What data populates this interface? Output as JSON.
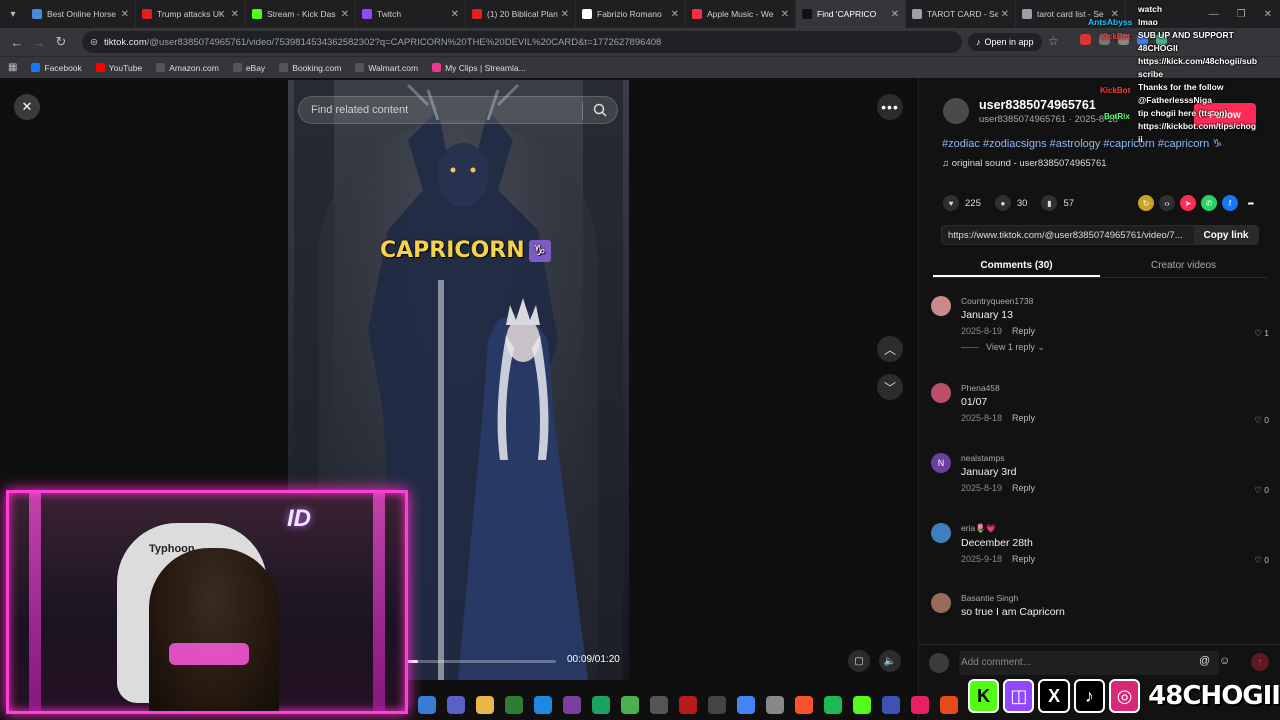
{
  "browser": {
    "tabs": [
      {
        "label": "Best Online Horse",
        "color": "#4a8bd8"
      },
      {
        "label": "Trump attacks UK",
        "color": "#e02020"
      },
      {
        "label": "Stream - Kick Das",
        "color": "#53fc18"
      },
      {
        "label": "Twitch",
        "color": "#9146ff"
      },
      {
        "label": "(1) 20 Biblical Plan",
        "color": "#e02020"
      },
      {
        "label": "Fabrizio Romano",
        "color": "#ffffff"
      },
      {
        "label": "Apple Music - We",
        "color": "#fa2d48"
      },
      {
        "label": "Find 'CAPRICO",
        "color": "#111111",
        "active": true
      },
      {
        "label": "TAROT CARD - Se",
        "color": "#9aa0a6"
      },
      {
        "label": "tarot card list - Se",
        "color": "#9aa0a6"
      }
    ],
    "url_host": "tiktok.com",
    "url_path": "/@user8385074965761/video/7539814534362582302?q=CAPRICORN%20THE%20DEVIL%20CARD&t=1772627896408",
    "open_in_app": "Open in app",
    "bookmarks": [
      {
        "label": "Facebook",
        "color": "#1877f2"
      },
      {
        "label": "YouTube",
        "color": "#ff0000"
      },
      {
        "label": "Amazon.com",
        "color": "#555555"
      },
      {
        "label": "eBay",
        "color": "#555555"
      },
      {
        "label": "Booking.com",
        "color": "#555555"
      },
      {
        "label": "Walmart.com",
        "color": "#555555"
      },
      {
        "label": "My Clips | Streamla...",
        "color": "#e8398d"
      }
    ]
  },
  "player": {
    "search_placeholder": "Find related content",
    "caption_text": "CAPRICORN",
    "caption_sign": "♑",
    "time": "00:09/01:20",
    "progress": 0.1125
  },
  "panel": {
    "author_name": "user8385074965761",
    "author_sub": "user8385074965761 · 2025-8-18",
    "follow_label": "Follow",
    "tags": "#zodiac #zodiacsigns #astrology #capricorn #capricorn ♑",
    "sound": "original sound - user8385074965761",
    "likes": "225",
    "comments_count": "30",
    "saves": "57",
    "link": "https://www.tiktok.com/@user8385074965761/video/7...",
    "copy_label": "Copy link",
    "tab_comments": "Comments (30)",
    "tab_creator": "Creator videos",
    "comments": [
      {
        "user": "Countryqueen1738",
        "text": "January 13",
        "date": "2025-8-19",
        "reply": "Reply",
        "likes": "1",
        "view_replies": "View 1 reply",
        "avatar_color": "#c98a8a",
        "initial": ""
      },
      {
        "user": "Phena458",
        "text": "01/07",
        "date": "2025-8-18",
        "reply": "Reply",
        "likes": "0",
        "avatar_color": "#b8506a",
        "initial": ""
      },
      {
        "user": "nealstamps",
        "text": "January 3rd",
        "date": "2025-8-19",
        "reply": "Reply",
        "likes": "0",
        "avatar_color": "#6a3fa0",
        "initial": "N"
      },
      {
        "user": "eria🌷💗",
        "text": "December 28th",
        "date": "2025-9-18",
        "reply": "Reply",
        "likes": "0",
        "avatar_color": "#3f7fc0",
        "initial": ""
      },
      {
        "user": "Basantie Singh",
        "text": "so true I am Capricorn",
        "date": "",
        "reply": "",
        "likes": "",
        "avatar_color": "#9a6a5a",
        "initial": ""
      }
    ],
    "add_comment_placeholder": "Add comment..."
  },
  "overlay": {
    "chat_lines": [
      "watch",
      "lmao",
      "SUB UP AND SUPPORT",
      "48CHOGII",
      "https://kick.com/48chogii/sub",
      "scribe",
      "Thanks for the follow",
      "@FatherlesssNiga",
      "tip chogii here (tts on)",
      "https://kickbot.com/tips/chog",
      "ii"
    ],
    "antsabyss": "AntsAbyss",
    "kickbot": "KickBot",
    "botrix": "BotRix",
    "chair_text": "Typhoon",
    "streamer_name": "48CHOGII"
  }
}
